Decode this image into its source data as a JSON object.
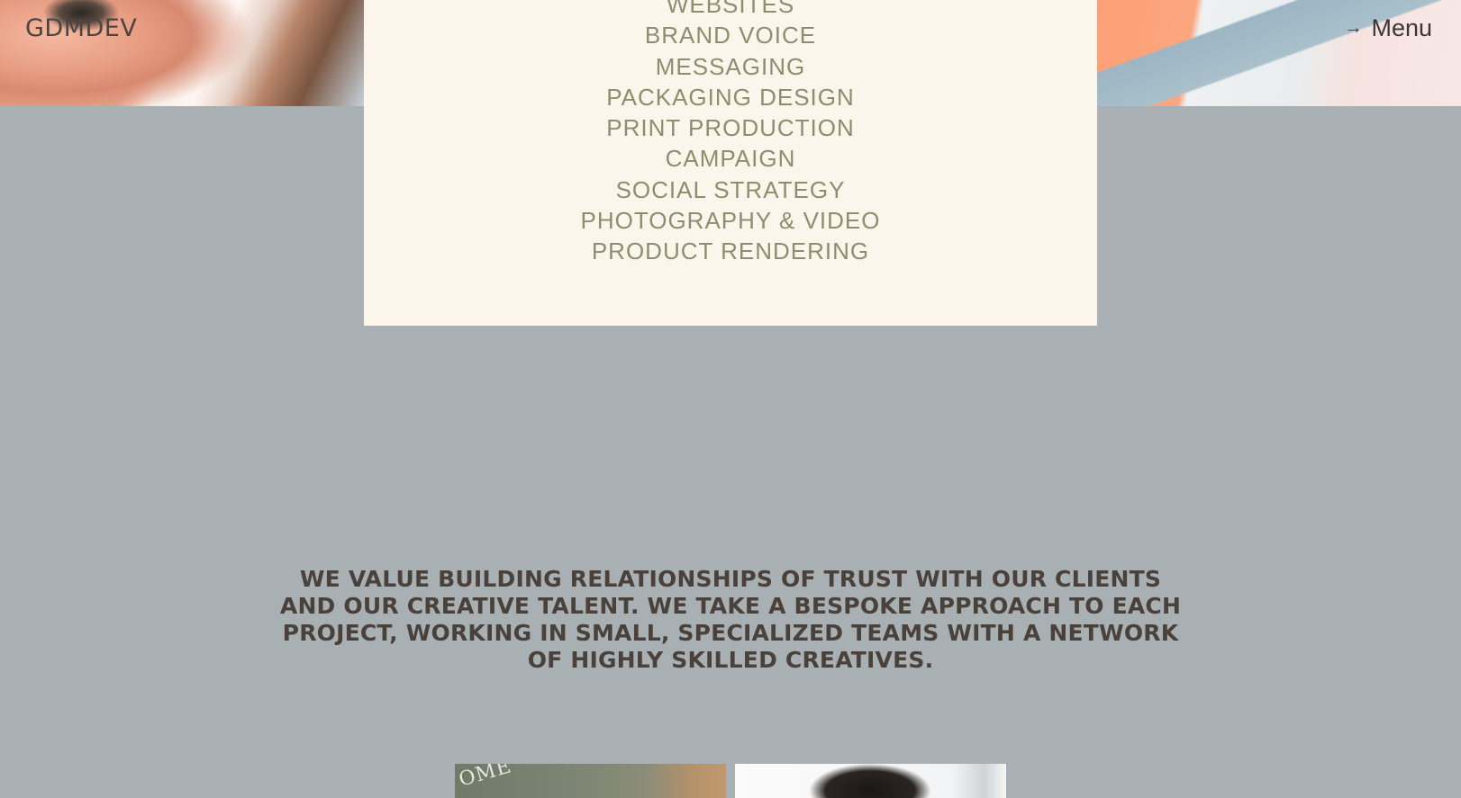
{
  "brand": {
    "logo": "GDMDEV"
  },
  "header": {
    "menu_label": "Menu"
  },
  "services": [
    "WEBSITES",
    "BRAND VOICE",
    "MESSAGING",
    "PACKAGING DESIGN",
    "PRINT PRODUCTION",
    "CAMPAIGN",
    "SOCIAL STRATEGY",
    "PHOTOGRAPHY & VIDEO",
    "PRODUCT RENDERING"
  ],
  "statement": "WE VALUE BUILDING RELATIONSHIPS OF TRUST WITH OUR CLIENTS AND OUR CREATIVE TALENT. WE TAKE A BESPOKE APPROACH TO EACH PROJECT, WORKING IN SMALL, SPECIALIZED TEAMS WITH A NETWORK OF HIGHLY SKILLED CREATIVES.",
  "gallery": {
    "thumb1_text": "OME"
  },
  "colors": {
    "page_background": "#a8b0b4",
    "panel_background": "#fbf5eb",
    "service_text": "#8d8e6d",
    "statement_text": "#4a413b"
  }
}
